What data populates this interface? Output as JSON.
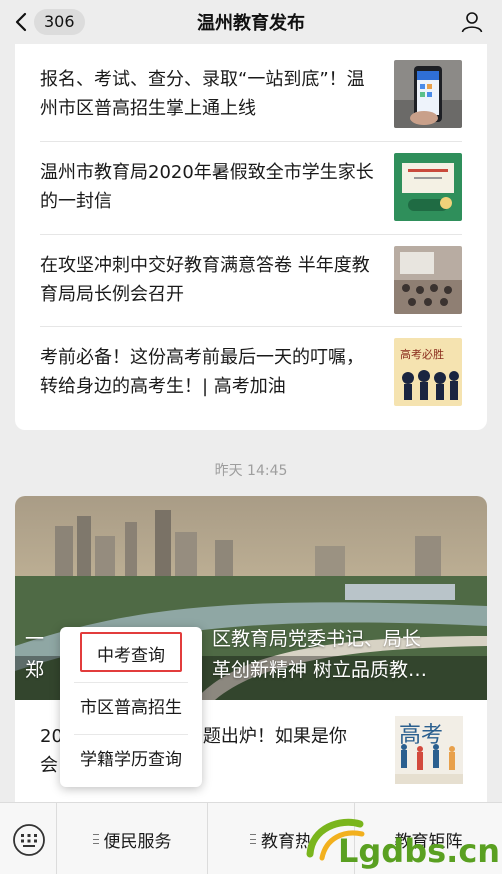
{
  "header": {
    "back_count": "306",
    "title": "温州教育发布"
  },
  "articles_top": [
    {
      "title": "报名、考试、查分、录取“一站到底”！温州市区普高招生掌上通上线",
      "thumb": "phone-app-photo"
    },
    {
      "title": "温州市教育局2020年暑假致全市学生家长的一封信",
      "thumb": "letter-illustration"
    },
    {
      "title": "在攻坚冲刺中交好教育满意答卷  半年度教育局局长例会召开",
      "thumb": "meeting-photo"
    },
    {
      "title": "考前必备！这份高考前最后一天的叮嘱，转给身边的高考生！| 高考加油",
      "thumb": "exam-cartoon"
    }
  ],
  "timestamp": "昨天 14:45",
  "article_cover": {
    "title": "一区教育局党委书记、局长郑革创新精神 树立品质教…",
    "title_line1_left": "一",
    "title_line1_right": "区教育局党委书记、局长",
    "title_line2_left": "郑",
    "title_line2_right": "革创新精神 树立品质教…"
  },
  "article_second": {
    "line1_left": "20",
    "line1_right": "题出炉！如果是你",
    "line2_left": "会"
  },
  "popup_menu": {
    "items": [
      "中考查询",
      "市区普高招生",
      "学籍学历查询"
    ],
    "highlight_color": "#e23c3c"
  },
  "bottom_menu": {
    "tabs": [
      "便民服务",
      "教育热",
      "教育矩阵"
    ]
  },
  "watermark_text": "Lgdbs.cn",
  "colors": {
    "background": "#ededed",
    "card": "#ffffff",
    "text": "#1a1a1a",
    "muted": "#9e9e9e"
  }
}
